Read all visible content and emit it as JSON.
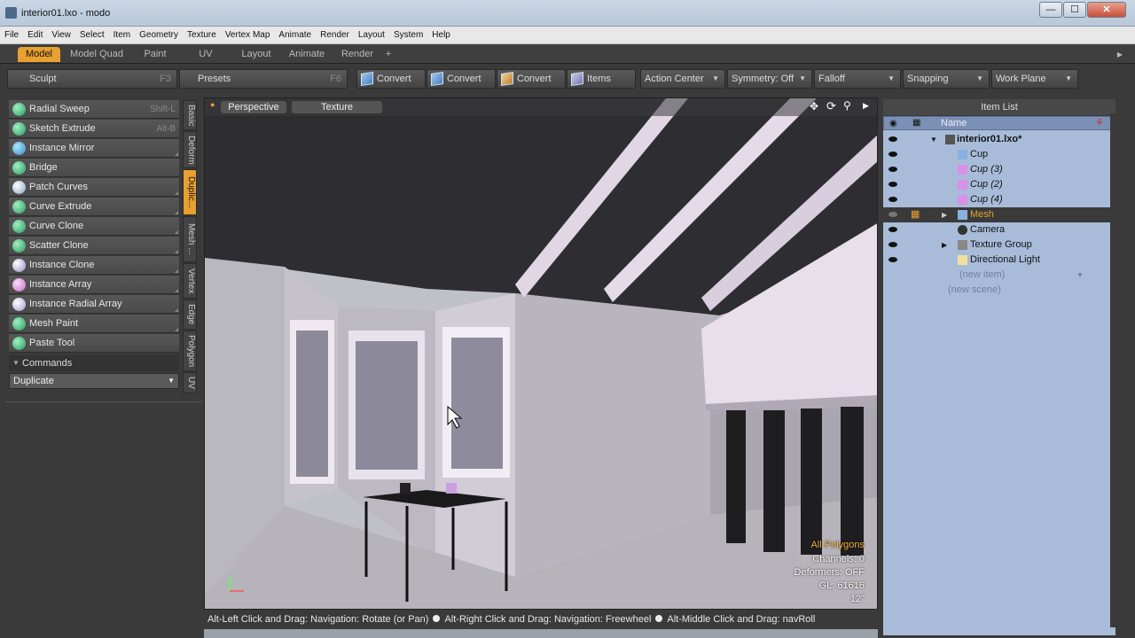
{
  "window": {
    "title": "interior01.lxo - modo",
    "min": "—",
    "max": "☐",
    "close": "✕"
  },
  "menu": [
    "File",
    "Edit",
    "View",
    "Select",
    "Item",
    "Geometry",
    "Texture",
    "Vertex Map",
    "Animate",
    "Render",
    "Layout",
    "System",
    "Help"
  ],
  "layout_tabs": [
    "Model",
    "Model Quad",
    "Paint",
    "UV",
    "Layout",
    "Animate",
    "Render",
    "+"
  ],
  "active_layout_tab": "Model",
  "toolbar": {
    "sculpt": {
      "label": "Sculpt",
      "key": "F3"
    },
    "presets": {
      "label": "Presets",
      "key": "F6"
    },
    "convert1": "Convert",
    "convert2": "Convert",
    "convert3": "Convert",
    "items": "Items",
    "action_center": "Action Center",
    "symmetry": "Symmetry: Off",
    "falloff": "Falloff",
    "snapping": "Snapping",
    "work_plane": "Work Plane"
  },
  "tools": [
    {
      "label": "Radial Sweep",
      "key": "Shift-L"
    },
    {
      "label": "Sketch Extrude",
      "key": "Alt-B"
    },
    {
      "label": "Instance Mirror",
      "key": ""
    },
    {
      "label": "Bridge",
      "key": ""
    },
    {
      "label": "Patch Curves",
      "key": ""
    },
    {
      "label": "Curve Extrude",
      "key": ""
    },
    {
      "label": "Curve Clone",
      "key": ""
    },
    {
      "label": "Scatter Clone",
      "key": ""
    },
    {
      "label": "Instance Clone",
      "key": ""
    },
    {
      "label": "Instance Array",
      "key": ""
    },
    {
      "label": "Instance Radial Array",
      "key": ""
    },
    {
      "label": "Mesh Paint",
      "key": ""
    },
    {
      "label": "Paste Tool",
      "key": ""
    }
  ],
  "commands": {
    "header": "Commands",
    "dropdown": "Duplicate"
  },
  "vertical_tabs": [
    "Basic",
    "Deform",
    "Duplic...",
    "Mesh ...",
    "Vertex",
    "Edge",
    "Polygon",
    "UV"
  ],
  "viewport": {
    "view_mode": "Perspective",
    "shading": "Texture",
    "info": [
      "All Polygons",
      "Channels: 0",
      "Deformers: OFF",
      "GL: 61616",
      "12\""
    ]
  },
  "status": {
    "hint1": "Alt-Left Click and Drag: Navigation: Rotate (or Pan)",
    "hint2": "Alt-Right Click and Drag: Navigation: Freewheel",
    "hint3": "Alt-Middle Click and Drag: navRoll"
  },
  "item_list": {
    "header": "Item List",
    "column": "Name",
    "scene": "interior01.lxo*",
    "items": [
      "Cup",
      "Cup (3)",
      "Cup (2)",
      "Cup (4)",
      "Mesh",
      "Camera",
      "Texture Group",
      "Directional Light"
    ],
    "new_item": "(new item)",
    "new_scene": "(new scene)"
  }
}
